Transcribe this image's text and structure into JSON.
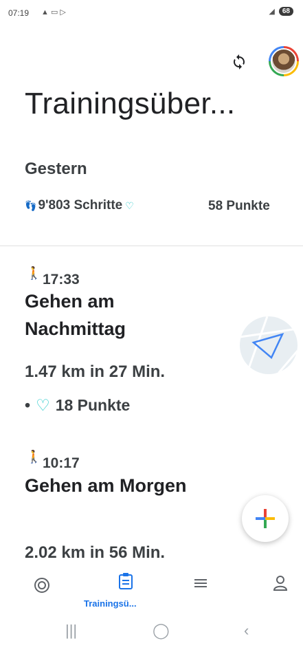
{
  "status_bar": {
    "time": "07:19",
    "battery": "68"
  },
  "header": {
    "title": "Trainingsüber..."
  },
  "day": {
    "title": "Gestern",
    "steps": "9'803 Schritte",
    "points": "58 Punkte"
  },
  "activities": [
    {
      "time": "17:33",
      "title": "Gehen am Nachmittag",
      "meta": "1.47 km in 27 Min.",
      "points": "18 Punkte"
    },
    {
      "time": "10:17",
      "title": "Gehen am Morgen",
      "meta": "2.02 km in 56 Min."
    }
  ],
  "bottom_nav": {
    "active_label": "Trainingsü..."
  },
  "colors": {
    "accent": "#1a73e8",
    "heart_points": "#1ec8c8"
  }
}
